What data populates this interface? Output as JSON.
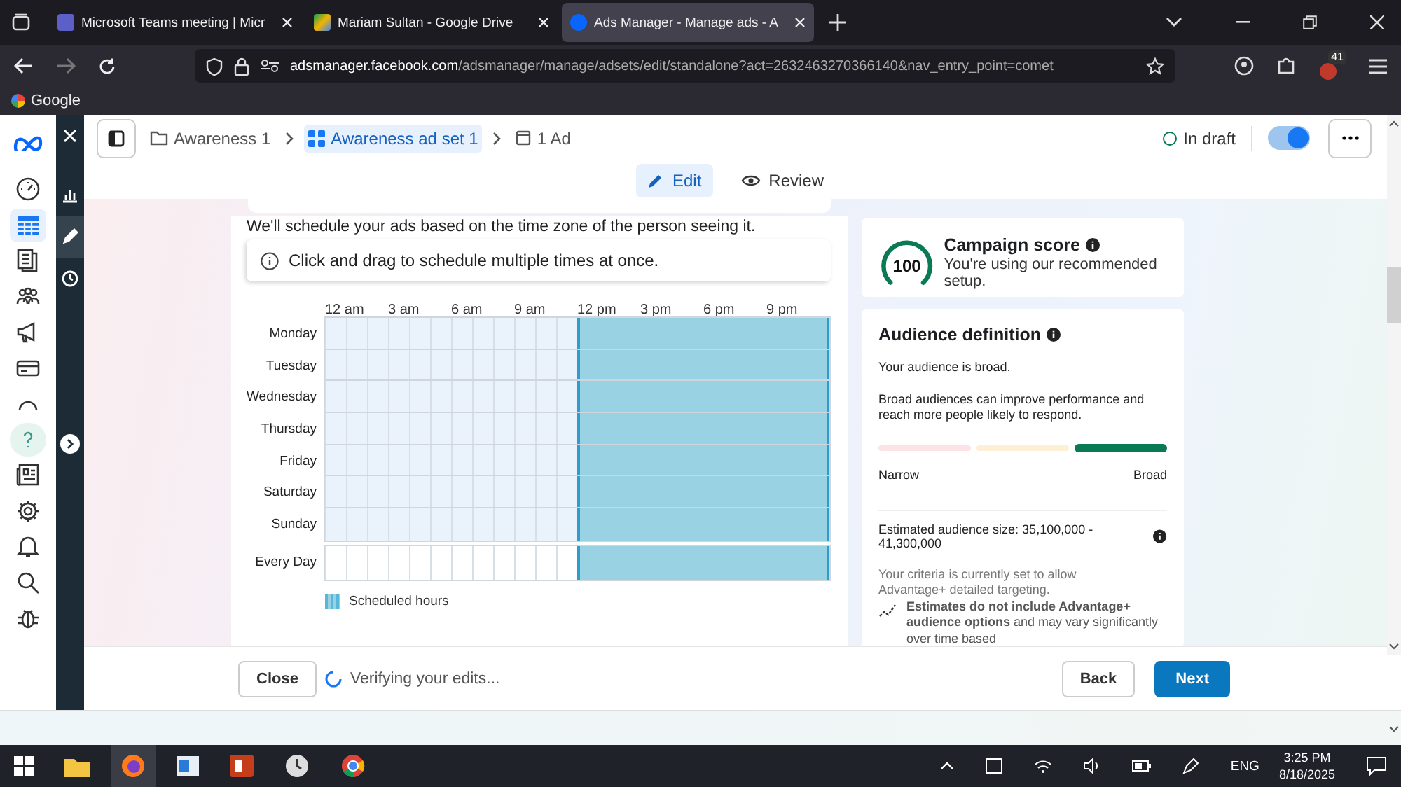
{
  "browser": {
    "tabs": [
      {
        "title": "Microsoft Teams meeting | Micr",
        "selected": false
      },
      {
        "title": "Mariam Sultan - Google Drive",
        "selected": false
      },
      {
        "title": "Ads Manager - Manage ads - A",
        "selected": true
      }
    ],
    "url_host": "adsmanager.facebook.com",
    "url_path": "/adsmanager/manage/adsets/edit/standalone?act=2632463270366140&nav_entry_point=comet",
    "extension_badge": "41",
    "bookmarks": [
      "Google"
    ]
  },
  "rail_items": [
    {
      "selected": false
    },
    {
      "selected": true
    },
    {
      "selected": false
    },
    {
      "selected": false
    },
    {
      "selected": false
    },
    {
      "selected": false
    },
    {
      "selected": false
    },
    {
      "selected": true
    },
    {
      "selected": false
    },
    {
      "selected": false
    },
    {
      "selected": false
    },
    {
      "selected": false
    },
    {
      "selected": false
    }
  ],
  "strip_items": [
    {
      "selected": false
    },
    {
      "selected": true
    },
    {
      "selected": false
    }
  ],
  "breadcrumbs": [
    {
      "label": "Awareness 1",
      "selected": false
    },
    {
      "label": "Awareness ad set 1",
      "selected": true
    },
    {
      "label": "1 Ad",
      "selected": false
    }
  ],
  "status": "In draft",
  "toggle_on": true,
  "modes": [
    {
      "label": "Edit",
      "selected": true
    },
    {
      "label": "Review",
      "selected": false
    }
  ],
  "schedule": {
    "note": "We'll schedule your ads based on the time zone of the person seeing it.",
    "hint": "Click and drag to schedule multiple times at once.",
    "hour_labels": [
      "12 am",
      "3 am",
      "6 am",
      "9 am",
      "12 pm",
      "3 pm",
      "6 pm",
      "9 pm"
    ],
    "rows": [
      {
        "day": "Monday",
        "hours": [
          false,
          false,
          false,
          false,
          false,
          false,
          false,
          false,
          false,
          false,
          false,
          false,
          true,
          true,
          true,
          true,
          true,
          true,
          true,
          true,
          true,
          true,
          true,
          true
        ]
      },
      {
        "day": "Tuesday",
        "hours": [
          false,
          false,
          false,
          false,
          false,
          false,
          false,
          false,
          false,
          false,
          false,
          false,
          true,
          true,
          true,
          true,
          true,
          true,
          true,
          true,
          true,
          true,
          true,
          true
        ]
      },
      {
        "day": "Wednesday",
        "hours": [
          false,
          false,
          false,
          false,
          false,
          false,
          false,
          false,
          false,
          false,
          false,
          false,
          true,
          true,
          true,
          true,
          true,
          true,
          true,
          true,
          true,
          true,
          true,
          true
        ]
      },
      {
        "day": "Thursday",
        "hours": [
          false,
          false,
          false,
          false,
          false,
          false,
          false,
          false,
          false,
          false,
          false,
          false,
          true,
          true,
          true,
          true,
          true,
          true,
          true,
          true,
          true,
          true,
          true,
          true
        ]
      },
      {
        "day": "Friday",
        "hours": [
          false,
          false,
          false,
          false,
          false,
          false,
          false,
          false,
          false,
          false,
          false,
          false,
          true,
          true,
          true,
          true,
          true,
          true,
          true,
          true,
          true,
          true,
          true,
          true
        ]
      },
      {
        "day": "Saturday",
        "hours": [
          false,
          false,
          false,
          false,
          false,
          false,
          false,
          false,
          false,
          false,
          false,
          false,
          true,
          true,
          true,
          true,
          true,
          true,
          true,
          true,
          true,
          true,
          true,
          true
        ]
      },
      {
        "day": "Sunday",
        "hours": [
          false,
          false,
          false,
          false,
          false,
          false,
          false,
          false,
          false,
          false,
          false,
          false,
          true,
          true,
          true,
          true,
          true,
          true,
          true,
          true,
          true,
          true,
          true,
          true
        ]
      },
      {
        "day": "Every Day",
        "hours": [
          false,
          false,
          false,
          false,
          false,
          false,
          false,
          false,
          false,
          false,
          false,
          false,
          true,
          true,
          true,
          true,
          true,
          true,
          true,
          true,
          true,
          true,
          true,
          true
        ]
      }
    ],
    "legend": "Scheduled hours"
  },
  "score": {
    "value": "100",
    "title": "Campaign score",
    "subtitle": "You're using our recommended setup."
  },
  "audience": {
    "title": "Audience definition",
    "summary": "Your audience is broad.",
    "description": "Broad audiences can improve performance and reach more people likely to respond.",
    "segments": [
      {
        "color": "#fbe3e6",
        "selected": false
      },
      {
        "color": "#fdf0d5",
        "selected": false
      },
      {
        "color": "#0a7a55",
        "selected": true
      }
    ],
    "low_label": "Narrow",
    "high_label": "Broad",
    "size": "Estimated audience size: 35,100,000 - 41,300,000",
    "criteria": "Your criteria is currently set to allow Advantage+ detailed targeting.",
    "estimate_note": "**Estimates do not include Advantage+ audience options** and may vary significantly over time based"
  },
  "footer": {
    "close": "Close",
    "status": "Verifying your edits...",
    "back": "Back",
    "next": "Next"
  },
  "taskbar": {
    "language": "ENG",
    "time": "3:25 PM",
    "date": "8/18/2025"
  }
}
